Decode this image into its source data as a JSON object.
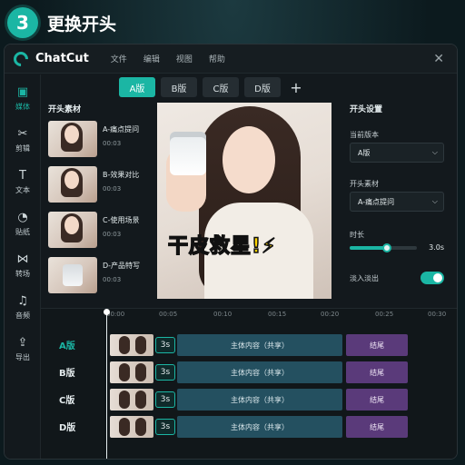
{
  "step": {
    "number": "3",
    "title": "更换开头"
  },
  "app": {
    "name": "ChatCut",
    "menu": [
      "文件",
      "编辑",
      "视图",
      "帮助"
    ],
    "close": "✕"
  },
  "sidebar": [
    {
      "icon": "▣",
      "label": "媒体",
      "active": true
    },
    {
      "icon": "✂",
      "label": "剪辑"
    },
    {
      "icon": "T",
      "label": "文本"
    },
    {
      "icon": "◔",
      "label": "贴纸"
    },
    {
      "icon": "⋈",
      "label": "转场"
    },
    {
      "icon": "♫",
      "label": "音频"
    },
    {
      "icon": "⇪",
      "label": "导出"
    }
  ],
  "tabs": {
    "items": [
      "A版",
      "B版",
      "C版",
      "D版"
    ],
    "active": "A版",
    "add": "+"
  },
  "material": {
    "title": "开头素材",
    "items": [
      {
        "name": "A-痛点提问",
        "time": "00:03"
      },
      {
        "name": "B-效果对比",
        "time": "00:03"
      },
      {
        "name": "C-使用场景",
        "time": "00:03"
      },
      {
        "name": "D-产品特写",
        "time": "00:03"
      }
    ]
  },
  "preview": {
    "caption_main": "干皮",
    "caption_highlight": "救星!",
    "caption_mark": "⚡"
  },
  "settings": {
    "title": "开头设置",
    "version_label": "当前版本",
    "version_value": "A版",
    "material_label": "开头素材",
    "material_value": "A-痛点提问",
    "duration_label": "时长",
    "duration_value": "3.0s",
    "duration_fraction": 0.55,
    "fade_label": "淡入淡出",
    "fade_on": true
  },
  "timeline": {
    "ticks": [
      "00:00",
      "00:05",
      "00:10",
      "00:15",
      "00:20",
      "00:25",
      "00:30"
    ],
    "tracks": [
      {
        "label": "A版",
        "duration": "3s",
        "main": "主体内容（共享）",
        "end": "结尾",
        "active": true
      },
      {
        "label": "B版",
        "duration": "3s",
        "main": "主体内容（共享）",
        "end": "结尾"
      },
      {
        "label": "C版",
        "duration": "3s",
        "main": "主体内容（共享）",
        "end": "结尾"
      },
      {
        "label": "D版",
        "duration": "3s",
        "main": "主体内容（共享）",
        "end": "结尾"
      }
    ]
  },
  "colors": {
    "accent": "#1bb6a4",
    "end_clip": "#5a3a7a",
    "main_clip": "#245060",
    "caption_highlight": "#ffd400"
  }
}
